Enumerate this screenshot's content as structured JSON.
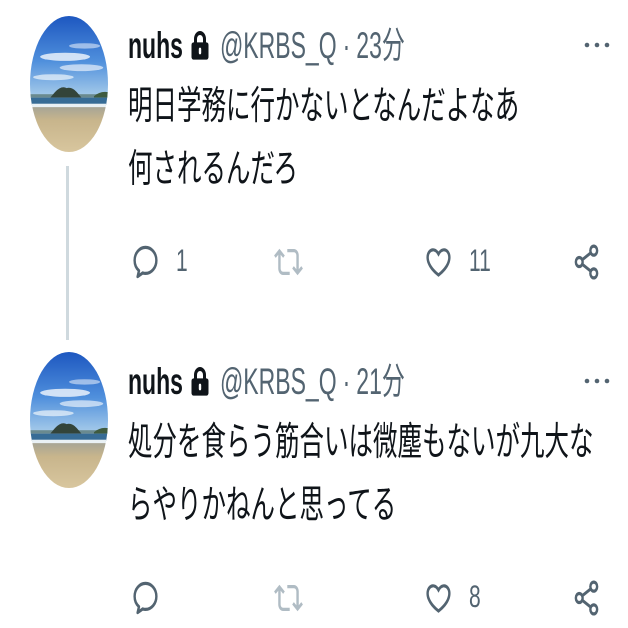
{
  "colors": {
    "background": "#ffffff",
    "text_primary": "#0f1419",
    "text_secondary": "#536471",
    "retweet_disabled": "#b0bcc4",
    "thread_line": "#cfd9de"
  },
  "icons": {
    "protected": "lock-icon",
    "more": "more-icon",
    "reply": "reply-icon",
    "retweet": "retweet-icon",
    "like": "heart-icon",
    "share": "share-icon"
  },
  "tweets": [
    {
      "display_name": "nuhs",
      "handle": "@KRBS_Q",
      "separator": "·",
      "time": "23分",
      "text_lines": [
        "明日学務に行かないとなんだよなあ",
        "何されるんだろ"
      ],
      "reply_count": "1",
      "like_count": "11"
    },
    {
      "display_name": "nuhs",
      "handle": "@KRBS_Q",
      "separator": "·",
      "time": "21分",
      "text_lines": [
        "処分を食らう筋合いは微塵もないが九大な",
        "らやりかねんと思ってる"
      ],
      "like_count": "8"
    }
  ]
}
